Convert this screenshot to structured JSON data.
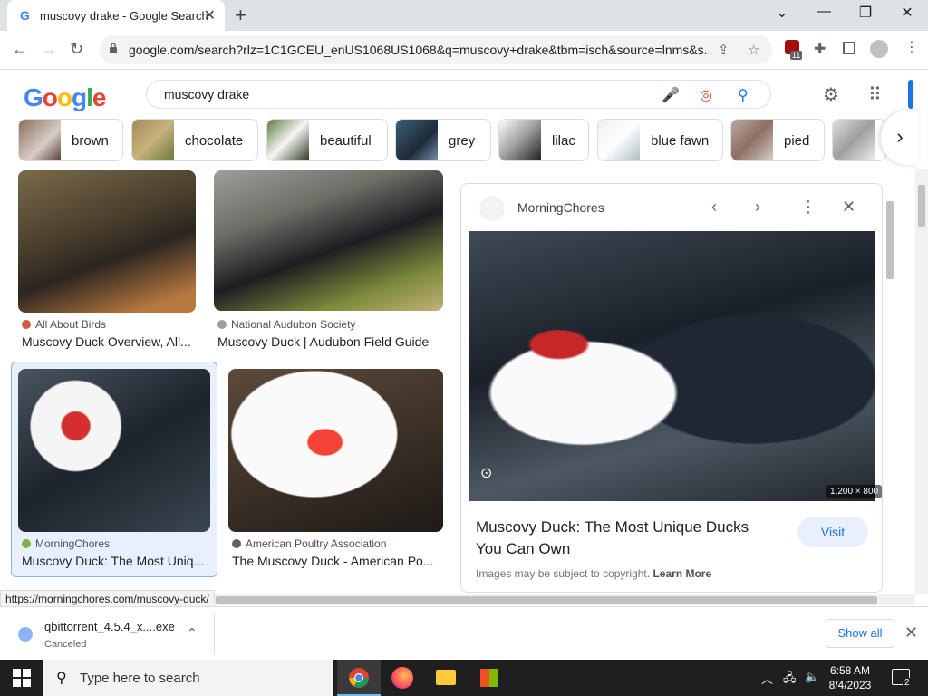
{
  "browser": {
    "tab_title": "muscovy drake - Google Search",
    "url": "google.com/search?rlz=1C1GCEU_enUS1068US1068&q=muscovy+drake&tbm=isch&source=lnms&s...",
    "extension_badge": "11"
  },
  "google": {
    "logo_text": "Google",
    "search_query": "muscovy drake"
  },
  "chips": [
    {
      "label": "brown"
    },
    {
      "label": "chocolate"
    },
    {
      "label": "beautiful"
    },
    {
      "label": "grey"
    },
    {
      "label": "lilac"
    },
    {
      "label": "blue fawn"
    },
    {
      "label": "pied"
    }
  ],
  "results": [
    {
      "source": "All About Birds",
      "title": "Muscovy Duck Overview, All..."
    },
    {
      "source": "National Audubon Society",
      "title": "Muscovy Duck | Audubon Field Guide"
    },
    {
      "source": "MorningChores",
      "title": "Muscovy Duck: The Most Uniq..."
    },
    {
      "source": "American Poultry Association",
      "title": "The Muscovy Duck - American Po..."
    }
  ],
  "preview": {
    "source": "MorningChores",
    "dimensions": "1,200 × 800",
    "title": "Muscovy Duck: The Most Unique Ducks You Can Own",
    "visit_label": "Visit",
    "copyright_text": "Images may be subject to copyright.",
    "learn_more": "Learn More"
  },
  "status_url": "https://morningchores.com/muscovy-duck/",
  "download": {
    "filename": "qbittorrent_4.5.4_x....exe",
    "status": "Canceled",
    "show_all": "Show all"
  },
  "taskbar": {
    "search_placeholder": "Type here to search",
    "time": "6:58 AM",
    "date": "8/4/2023",
    "notification_count": "2"
  },
  "colors": {
    "accent": "#1a73e8",
    "selected_bg": "#e8f0fe"
  }
}
